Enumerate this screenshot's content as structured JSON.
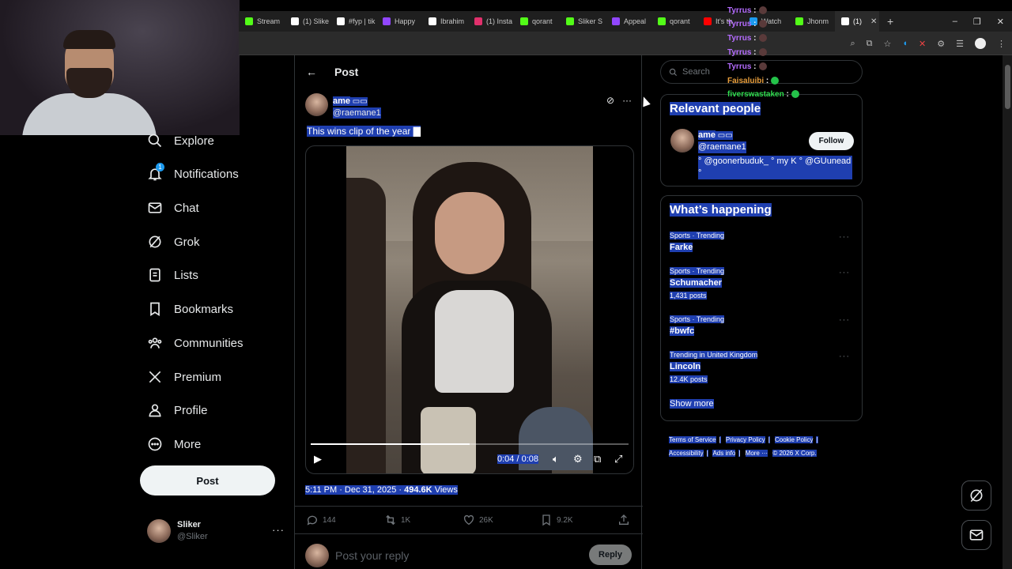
{
  "browser": {
    "tabs": [
      {
        "label": "Stream",
        "color": "#53fc18"
      },
      {
        "label": "(1) Slike",
        "color": "#ffffff"
      },
      {
        "label": "#fyp | tik",
        "color": "#ffffff"
      },
      {
        "label": "Happy",
        "color": "#9146ff"
      },
      {
        "label": "Ibrahim",
        "color": "#ffffff"
      },
      {
        "label": "(1) Insta",
        "color": "#e1306c"
      },
      {
        "label": "qorant",
        "color": "#53fc18"
      },
      {
        "label": "Sliker S",
        "color": "#53fc18"
      },
      {
        "label": "Appeal",
        "color": "#9146ff"
      },
      {
        "label": "qorant",
        "color": "#53fc18"
      },
      {
        "label": "It's th",
        "color": "#ff0000"
      },
      {
        "label": "Watch",
        "color": "#1d9bf0"
      },
      {
        "label": "Jhonm",
        "color": "#53fc18"
      },
      {
        "label": "(1)",
        "color": "#ffffff",
        "active": true
      }
    ],
    "new_tab": "+",
    "window_controls": [
      "–",
      "❐",
      "✕"
    ]
  },
  "stream_chat": [
    {
      "name": "Tyrrus",
      "sep": ":",
      "emote": "dark"
    },
    {
      "name": "Tyrrus",
      "sep": ":",
      "emote": "dark"
    },
    {
      "name": "Tyrrus",
      "sep": ":",
      "emote": "dark"
    },
    {
      "name": "Tyrrus",
      "sep": ":",
      "emote": "dark"
    },
    {
      "name": "Tyrrus",
      "sep": ":",
      "emote": "dark"
    },
    {
      "name": "Faisaluibi",
      "sep": ":",
      "emote": "green",
      "color": "#e89e3c"
    },
    {
      "name": "fiverswastaken",
      "sep": ":",
      "emote": "green",
      "color": "#2fdd4e"
    }
  ],
  "nav": {
    "items": [
      {
        "label": "Explore",
        "icon": "search-icon"
      },
      {
        "label": "Notifications",
        "icon": "bell-icon",
        "badge": "1"
      },
      {
        "label": "Chat",
        "icon": "mail-icon"
      },
      {
        "label": "Grok",
        "icon": "grok-icon"
      },
      {
        "label": "Lists",
        "icon": "list-icon"
      },
      {
        "label": "Bookmarks",
        "icon": "bookmark-icon"
      },
      {
        "label": "Communities",
        "icon": "communities-icon"
      },
      {
        "label": "Premium",
        "icon": "x-logo-icon"
      },
      {
        "label": "Profile",
        "icon": "profile-icon"
      },
      {
        "label": "More",
        "icon": "more-circle-icon"
      }
    ],
    "post_button": "Post",
    "account": {
      "display_name": "Sliker",
      "handle": "@Sliker",
      "more": "···"
    }
  },
  "post": {
    "header": "Post",
    "back": "←",
    "author_name": "ame",
    "author_handle": "@raemane1",
    "text": "This wins clip of the year",
    "video": {
      "time": "0:04 / 0:08",
      "progress": 0.5
    },
    "timestamp": "5:11 PM · Dec 31, 2025 · ",
    "views_count": "494.6K",
    "views_label": "Views",
    "actions": {
      "replies": "144",
      "reposts": "1K",
      "likes": "26K",
      "bookmarks": "9.2K"
    },
    "reply_placeholder": "Post your reply",
    "reply_button": "Reply"
  },
  "sidebar": {
    "search_placeholder": "Search",
    "relevant": {
      "title": "Relevant people",
      "name": "ame",
      "handle": "@raemane1",
      "follow": "Follow",
      "bio": "° @goonerbuduk_ ° my K ° @GUunead °"
    },
    "happening": {
      "title": "What’s happening",
      "trends": [
        {
          "context": "Sports · Trending",
          "topic": "Farke",
          "posts": ""
        },
        {
          "context": "Sports · Trending",
          "topic": "Schumacher",
          "posts": "1,431 posts"
        },
        {
          "context": "Sports · Trending",
          "topic": "#bwfc",
          "posts": ""
        },
        {
          "context": "Trending in United Kingdom",
          "topic": "Lincoln",
          "posts": "12.4K posts"
        }
      ],
      "show_more": "Show more"
    },
    "footer": [
      "Terms of Service",
      "|",
      "Privacy Policy",
      "|",
      "Cookie Policy",
      "|",
      "Accessibility",
      "|",
      "Ads info",
      "|",
      "More ···",
      "© 2026 X Corp."
    ]
  },
  "colors": {
    "accent": "#1d9bf0",
    "selection": "#1f3fb0",
    "border": "#2f3336",
    "muted": "#71767b"
  }
}
